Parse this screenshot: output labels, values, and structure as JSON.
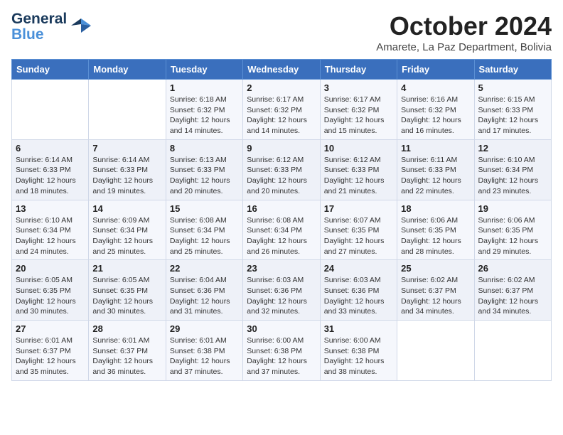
{
  "logo": {
    "line1": "General",
    "line2": "Blue"
  },
  "title": "October 2024",
  "subtitle": "Amarete, La Paz Department, Bolivia",
  "days_of_week": [
    "Sunday",
    "Monday",
    "Tuesday",
    "Wednesday",
    "Thursday",
    "Friday",
    "Saturday"
  ],
  "weeks": [
    [
      {
        "day": "",
        "text": ""
      },
      {
        "day": "",
        "text": ""
      },
      {
        "day": "1",
        "text": "Sunrise: 6:18 AM\nSunset: 6:32 PM\nDaylight: 12 hours and 14 minutes."
      },
      {
        "day": "2",
        "text": "Sunrise: 6:17 AM\nSunset: 6:32 PM\nDaylight: 12 hours and 14 minutes."
      },
      {
        "day": "3",
        "text": "Sunrise: 6:17 AM\nSunset: 6:32 PM\nDaylight: 12 hours and 15 minutes."
      },
      {
        "day": "4",
        "text": "Sunrise: 6:16 AM\nSunset: 6:32 PM\nDaylight: 12 hours and 16 minutes."
      },
      {
        "day": "5",
        "text": "Sunrise: 6:15 AM\nSunset: 6:33 PM\nDaylight: 12 hours and 17 minutes."
      }
    ],
    [
      {
        "day": "6",
        "text": "Sunrise: 6:14 AM\nSunset: 6:33 PM\nDaylight: 12 hours and 18 minutes."
      },
      {
        "day": "7",
        "text": "Sunrise: 6:14 AM\nSunset: 6:33 PM\nDaylight: 12 hours and 19 minutes."
      },
      {
        "day": "8",
        "text": "Sunrise: 6:13 AM\nSunset: 6:33 PM\nDaylight: 12 hours and 20 minutes."
      },
      {
        "day": "9",
        "text": "Sunrise: 6:12 AM\nSunset: 6:33 PM\nDaylight: 12 hours and 20 minutes."
      },
      {
        "day": "10",
        "text": "Sunrise: 6:12 AM\nSunset: 6:33 PM\nDaylight: 12 hours and 21 minutes."
      },
      {
        "day": "11",
        "text": "Sunrise: 6:11 AM\nSunset: 6:33 PM\nDaylight: 12 hours and 22 minutes."
      },
      {
        "day": "12",
        "text": "Sunrise: 6:10 AM\nSunset: 6:34 PM\nDaylight: 12 hours and 23 minutes."
      }
    ],
    [
      {
        "day": "13",
        "text": "Sunrise: 6:10 AM\nSunset: 6:34 PM\nDaylight: 12 hours and 24 minutes."
      },
      {
        "day": "14",
        "text": "Sunrise: 6:09 AM\nSunset: 6:34 PM\nDaylight: 12 hours and 25 minutes."
      },
      {
        "day": "15",
        "text": "Sunrise: 6:08 AM\nSunset: 6:34 PM\nDaylight: 12 hours and 25 minutes."
      },
      {
        "day": "16",
        "text": "Sunrise: 6:08 AM\nSunset: 6:34 PM\nDaylight: 12 hours and 26 minutes."
      },
      {
        "day": "17",
        "text": "Sunrise: 6:07 AM\nSunset: 6:35 PM\nDaylight: 12 hours and 27 minutes."
      },
      {
        "day": "18",
        "text": "Sunrise: 6:06 AM\nSunset: 6:35 PM\nDaylight: 12 hours and 28 minutes."
      },
      {
        "day": "19",
        "text": "Sunrise: 6:06 AM\nSunset: 6:35 PM\nDaylight: 12 hours and 29 minutes."
      }
    ],
    [
      {
        "day": "20",
        "text": "Sunrise: 6:05 AM\nSunset: 6:35 PM\nDaylight: 12 hours and 30 minutes."
      },
      {
        "day": "21",
        "text": "Sunrise: 6:05 AM\nSunset: 6:35 PM\nDaylight: 12 hours and 30 minutes."
      },
      {
        "day": "22",
        "text": "Sunrise: 6:04 AM\nSunset: 6:36 PM\nDaylight: 12 hours and 31 minutes."
      },
      {
        "day": "23",
        "text": "Sunrise: 6:03 AM\nSunset: 6:36 PM\nDaylight: 12 hours and 32 minutes."
      },
      {
        "day": "24",
        "text": "Sunrise: 6:03 AM\nSunset: 6:36 PM\nDaylight: 12 hours and 33 minutes."
      },
      {
        "day": "25",
        "text": "Sunrise: 6:02 AM\nSunset: 6:37 PM\nDaylight: 12 hours and 34 minutes."
      },
      {
        "day": "26",
        "text": "Sunrise: 6:02 AM\nSunset: 6:37 PM\nDaylight: 12 hours and 34 minutes."
      }
    ],
    [
      {
        "day": "27",
        "text": "Sunrise: 6:01 AM\nSunset: 6:37 PM\nDaylight: 12 hours and 35 minutes."
      },
      {
        "day": "28",
        "text": "Sunrise: 6:01 AM\nSunset: 6:37 PM\nDaylight: 12 hours and 36 minutes."
      },
      {
        "day": "29",
        "text": "Sunrise: 6:01 AM\nSunset: 6:38 PM\nDaylight: 12 hours and 37 minutes."
      },
      {
        "day": "30",
        "text": "Sunrise: 6:00 AM\nSunset: 6:38 PM\nDaylight: 12 hours and 37 minutes."
      },
      {
        "day": "31",
        "text": "Sunrise: 6:00 AM\nSunset: 6:38 PM\nDaylight: 12 hours and 38 minutes."
      },
      {
        "day": "",
        "text": ""
      },
      {
        "day": "",
        "text": ""
      }
    ]
  ]
}
